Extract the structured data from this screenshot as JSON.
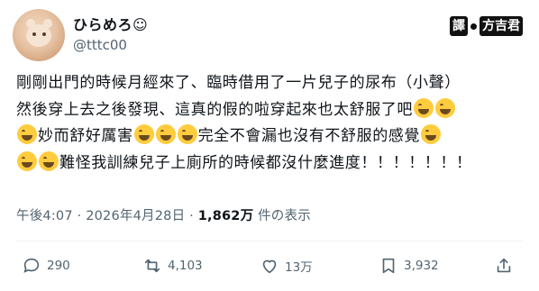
{
  "author": {
    "display_name": "ひらめろ☺",
    "handle": "@tttc00"
  },
  "brand_logo": {
    "text": "譯",
    "text2": "方吉君"
  },
  "tweet": {
    "line1": "剛剛出門的時候月經來了、臨時借用了一片兒子的尿布（小聲）",
    "line2": "然後穿上去之後發現、這真的假的啦穿起來也太舒服了吧",
    "line3a": "妙而舒好厲害",
    "line3b": "完全不會漏也沒有不舒服的感覺",
    "line4": "難怪我訓練兒子上廁所的時候都沒什麼進度！！！！！！！",
    "emoji": "joy-emoji"
  },
  "meta": {
    "time": "午後4:07",
    "sep1": " · ",
    "date": "2026年4月28日",
    "sep2": " · ",
    "views": "1,862万",
    "views_suffix": " 件の表示"
  },
  "actions": {
    "replies": "290",
    "reposts": "4,103",
    "likes": "13万",
    "bookmarks": "3,932"
  },
  "colors": {
    "text": "#0f1419",
    "secondary": "#536471",
    "divider": "#eff3f4"
  }
}
